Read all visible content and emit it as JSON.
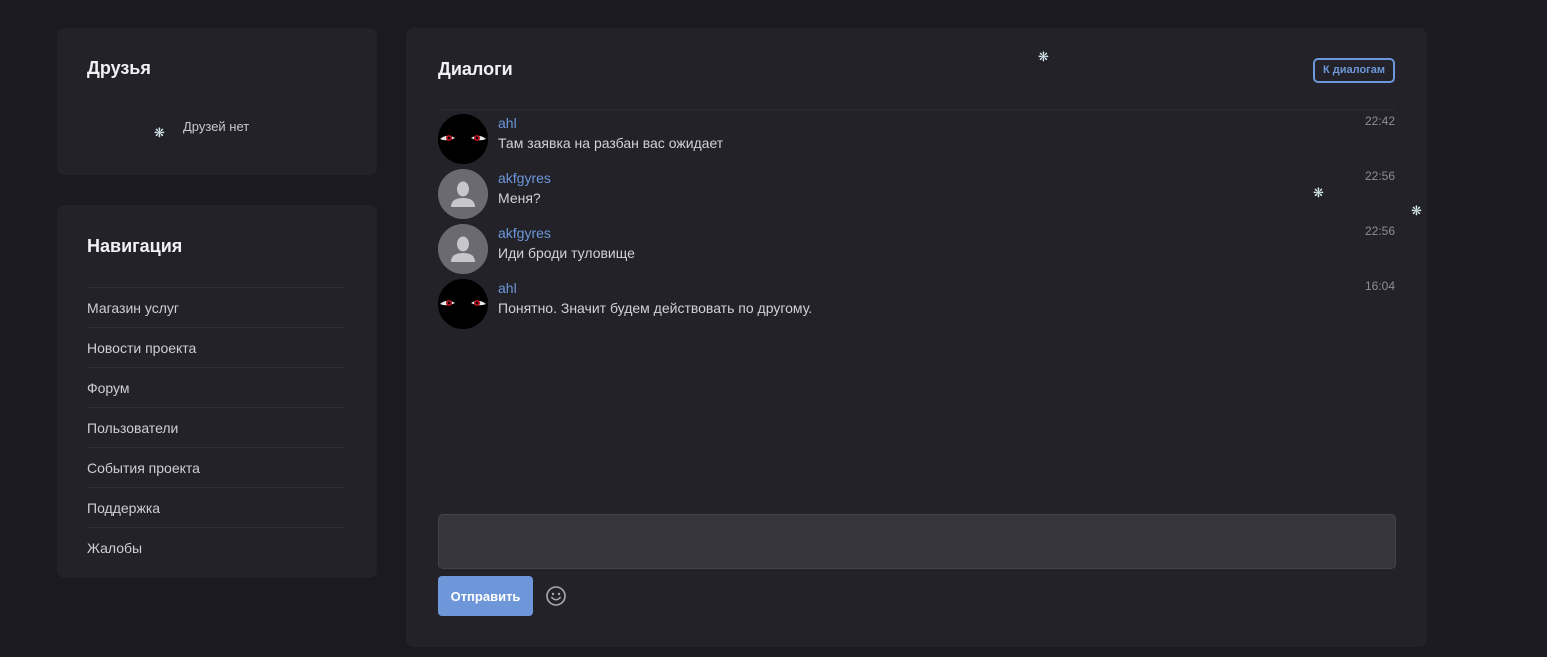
{
  "friends": {
    "title": "Друзья",
    "empty_text": "Друзей нет"
  },
  "navigation": {
    "title": "Навигация",
    "items": [
      {
        "label": "Магазин услуг"
      },
      {
        "label": "Новости проекта"
      },
      {
        "label": "Форум"
      },
      {
        "label": "Пользователи"
      },
      {
        "label": "События проекта"
      },
      {
        "label": "Поддержка"
      },
      {
        "label": "Жалобы"
      }
    ]
  },
  "dialogs": {
    "title": "Диалоги",
    "back_button_label": "К диалогам",
    "messages": [
      {
        "author": "ahl",
        "text": "Там заявка на разбан вас ожидает",
        "time": "22:42",
        "avatar": "dark-eyes-avatar"
      },
      {
        "author": "akfgyres",
        "text": "Меня?",
        "time": "22:56",
        "avatar": "default-user-avatar"
      },
      {
        "author": "akfgyres",
        "text": "Иди броди туловище",
        "time": "22:56",
        "avatar": "default-user-avatar"
      },
      {
        "author": "ahl",
        "text": "Понятно. Значит будем действовать по другому.",
        "time": "16:04",
        "avatar": "dark-eyes-avatar"
      }
    ],
    "input_placeholder": "",
    "send_label": "Отправить",
    "emoji_icon": "smiley-icon"
  },
  "decor": {
    "snowflake_icon": "snowflake-icon",
    "snowflake_color": "#d6ecf0"
  },
  "colors": {
    "accent": "#6d97d9",
    "background": "#1b1a20",
    "card": "#232229"
  }
}
